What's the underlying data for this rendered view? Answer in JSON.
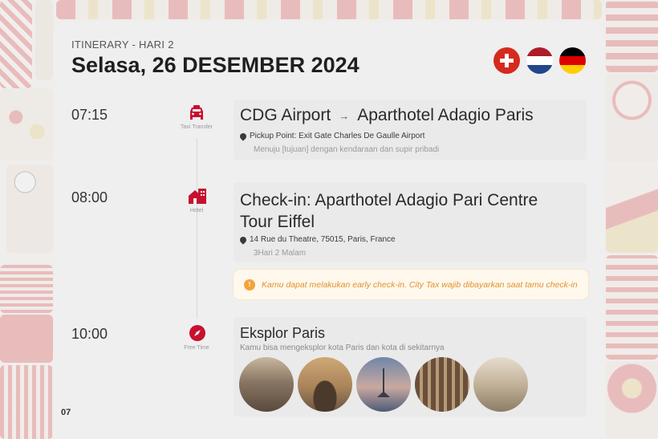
{
  "header": {
    "eyebrow": "ITINERARY - HARI 2",
    "title": "Selasa, 26 DESEMBER 2024",
    "flags": [
      "switzerland-flag",
      "netherlands-flag",
      "germany-flag"
    ]
  },
  "timeline": [
    {
      "time": "07:15",
      "icon": "taxi-icon",
      "icon_caption": "Taxi Transfer",
      "from": "CDG Airport",
      "arrow": "→",
      "to": "Aparthotel Adagio Paris",
      "location": "Pickup Point: Exit Gate Charles De Gaulle Airport",
      "note": "Menuju [tujuan] dengan kendaraan dan supir pribadi"
    },
    {
      "time": "08:00",
      "icon": "hotel-icon",
      "icon_caption": "Hotel",
      "title_line1": "Check-in: Aparthotel Adagio Pari Centre",
      "title_line2": "Tour Eiffel",
      "location": "14 Rue du Theatre, 75015, Paris, France",
      "note": "3Hari 2 Malam",
      "notice": "Kamu dapat melakukan early check-in. City Tax wajib dibayarkan saat tamu check-in"
    },
    {
      "time": "10:00",
      "icon": "compass-icon",
      "icon_caption": "Free Time",
      "title": "Eksplor Paris",
      "note": "Kamu bisa mengeksplor kota Paris dan kota di sekitarnya"
    }
  ],
  "page_number": "07",
  "colors": {
    "accent": "#c8102e",
    "notice_bg": "#fff8ec",
    "notice_text": "#e2912b"
  }
}
